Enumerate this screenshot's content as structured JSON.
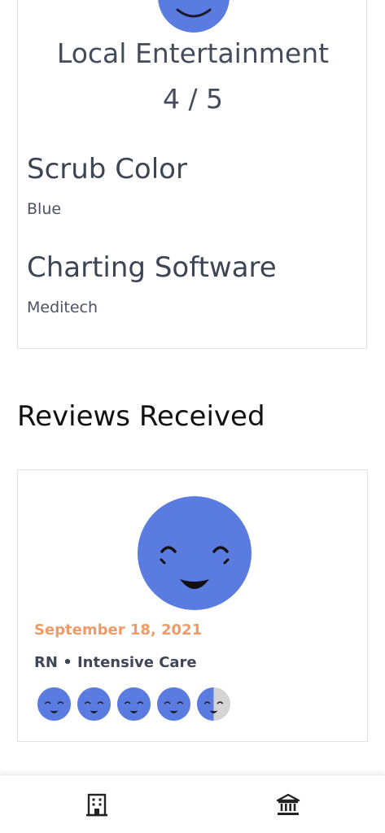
{
  "profile_card": {
    "rating": {
      "label": "Local Entertainment",
      "value": "4 / 5",
      "icon": "happy-face-icon"
    },
    "fields": [
      {
        "title": "Scrub Color",
        "value": "Blue"
      },
      {
        "title": "Charting Software",
        "value": "Meditech"
      }
    ]
  },
  "reviews_section": {
    "title": "Reviews Received",
    "reviews": [
      {
        "date": "September 18, 2021",
        "role": "RN • Intensive Care",
        "avatar_icon": "happy-face-icon",
        "rating": 4.5,
        "rating_max": 5
      }
    ]
  },
  "bottom_nav": {
    "items": [
      {
        "icon": "building-icon"
      },
      {
        "icon": "bank-icon"
      }
    ]
  },
  "colors": {
    "face_blue": "#5a7be0",
    "date_orange": "#ef9a67",
    "empty_gray": "#d4d4d4"
  }
}
